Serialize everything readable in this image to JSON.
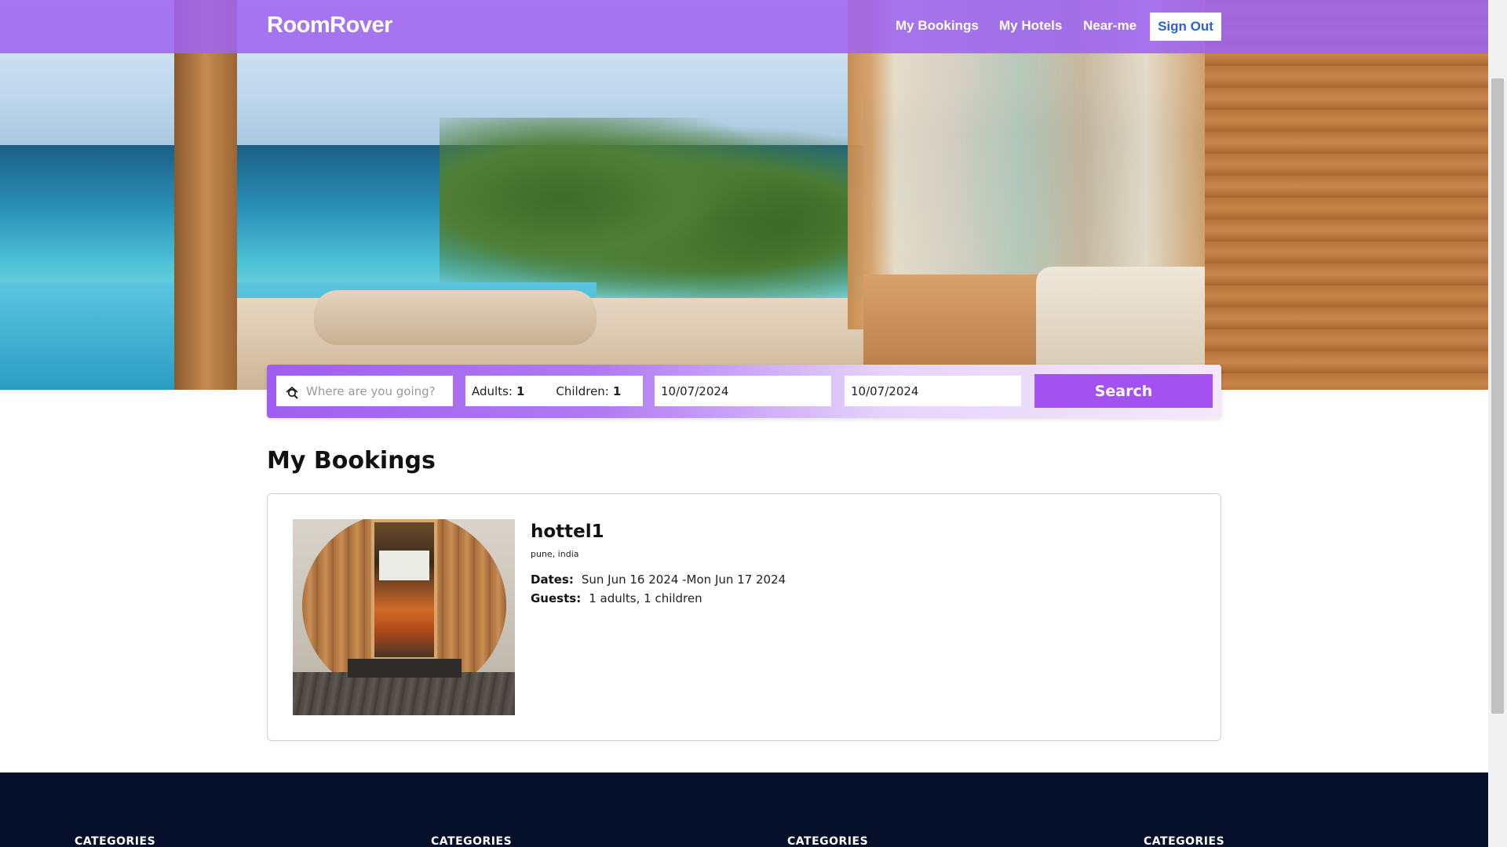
{
  "navbar": {
    "brand": "RoomRover",
    "links": [
      "My Bookings",
      "My Hotels",
      "Near-me"
    ],
    "sign_out": "Sign Out"
  },
  "search": {
    "destination_placeholder": "Where are you going?",
    "adults_label": "Adults:",
    "adults_value": "1",
    "children_label": "Children:",
    "children_value": "1",
    "check_in": "10/07/2024",
    "check_out": "10/07/2024",
    "button": "Search"
  },
  "main": {
    "title": "My Bookings",
    "bookings": [
      {
        "name": "hottel1",
        "location": "pune, india",
        "dates_label": "Dates:",
        "dates_value": "Sun Jun 16 2024 -Mon Jun 17 2024",
        "guests_label": "Guests:",
        "guests_value": "1 adults, 1 children"
      }
    ]
  },
  "footer": {
    "columns": [
      "CATEGORIES",
      "CATEGORIES",
      "CATEGORIES",
      "CATEGORIES"
    ]
  },
  "colors": {
    "nav_bg": "#9e64f0",
    "accent": "#a451f2",
    "signout_text": "#2d5fd6",
    "footer_bg": "#050f2a"
  }
}
